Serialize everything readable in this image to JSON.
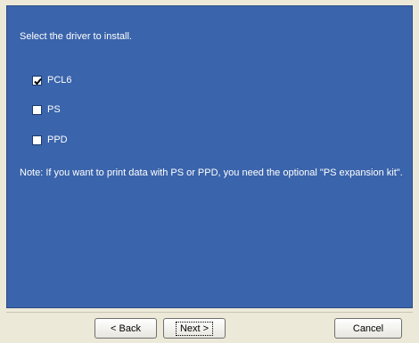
{
  "dialog": {
    "prompt": "Select the driver to install.",
    "options": [
      {
        "label": "PCL6",
        "checked": true
      },
      {
        "label": "PS",
        "checked": false
      },
      {
        "label": "PPD",
        "checked": false
      }
    ],
    "note": "Note: If you want to print data with PS or PPD, you need the optional \"PS expansion kit\"."
  },
  "buttons": {
    "back": "< Back",
    "next": "Next >",
    "cancel": "Cancel"
  },
  "colors": {
    "panel": "#3a64ab",
    "window": "#ece9d8"
  }
}
